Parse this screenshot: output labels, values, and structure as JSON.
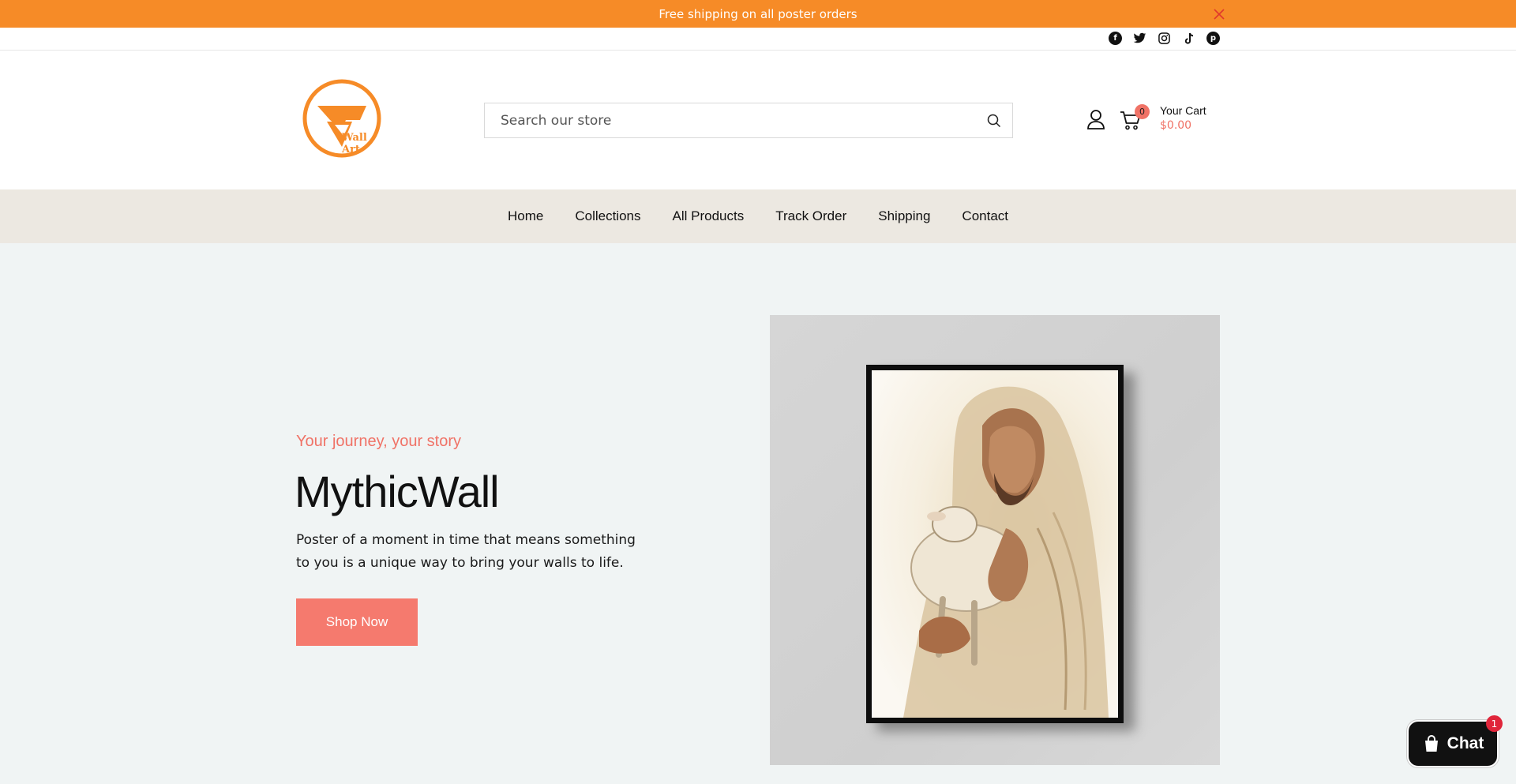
{
  "announcement": {
    "text": "Free shipping on all poster orders",
    "close_icon": "close-icon"
  },
  "social": {
    "icons": [
      "facebook-icon",
      "twitter-icon",
      "instagram-icon",
      "tiktok-icon",
      "pinterest-icon"
    ]
  },
  "header": {
    "logo_text": "Wall Art",
    "search_placeholder": "Search our store",
    "cart_count": "0",
    "cart_label": "Your Cart",
    "cart_total": "$0.00"
  },
  "nav": {
    "items": [
      "Home",
      "Collections",
      "All Products",
      "Track Order",
      "Shipping",
      "Contact"
    ]
  },
  "hero": {
    "subheading": "Your journey, your story",
    "title": "MythicWall",
    "description": "Poster of a moment in time that means something to you is a unique way to bring your walls to life.",
    "button_label": "Shop Now"
  },
  "chat": {
    "label": "Chat",
    "badge": "1"
  },
  "colors": {
    "announcement_bg": "#f68b27",
    "accent": "#f07266",
    "nav_bg": "#ece8e1",
    "hero_bg": "#f0f4f4"
  }
}
